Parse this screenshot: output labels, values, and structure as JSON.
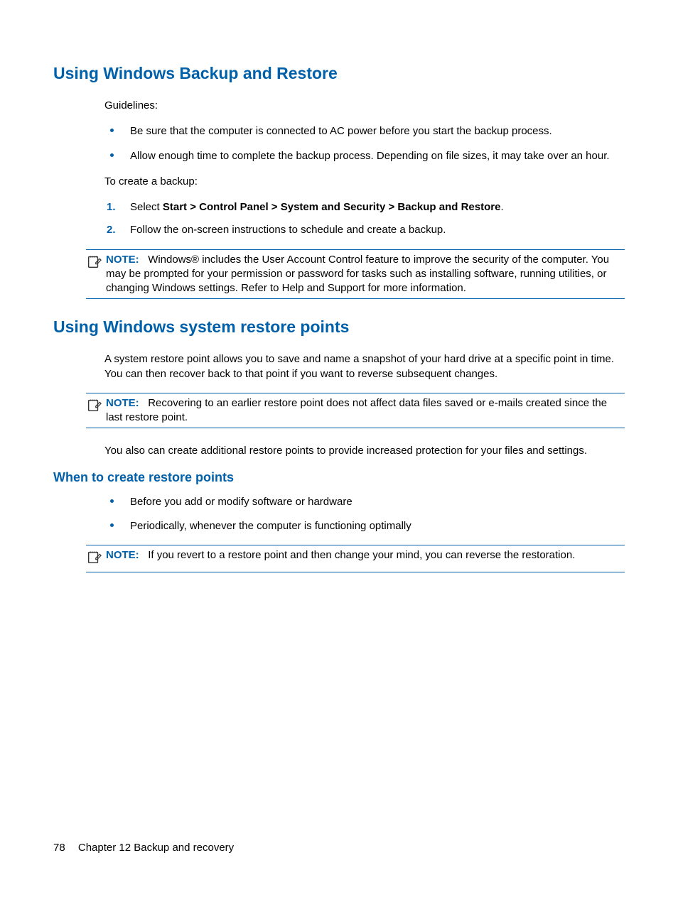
{
  "section1": {
    "heading": "Using Windows Backup and Restore",
    "guidelines_label": "Guidelines:",
    "bullets": [
      "Be sure that the computer is connected to AC power before you start the backup process.",
      "Allow enough time to complete the backup process. Depending on file sizes, it may take over an hour."
    ],
    "create_backup_label": "To create a backup:",
    "steps": [
      {
        "num": "1.",
        "prefix": "Select ",
        "bold": "Start > Control Panel > System and Security > Backup and Restore",
        "suffix": "."
      },
      {
        "num": "2.",
        "prefix": "Follow the on-screen instructions to schedule and create a backup.",
        "bold": "",
        "suffix": ""
      }
    ],
    "note": {
      "label": "NOTE:",
      "text": "Windows® includes the User Account Control feature to improve the security of the computer. You may be prompted for your permission or password for tasks such as installing software, running utilities, or changing Windows settings. Refer to Help and Support for more information."
    }
  },
  "section2": {
    "heading": "Using Windows system restore points",
    "p1": "A system restore point allows you to save and name a snapshot of your hard drive at a specific point in time. You can then recover back to that point if you want to reverse subsequent changes.",
    "note1": {
      "label": "NOTE:",
      "text": "Recovering to an earlier restore point does not affect data files saved or e-mails created since the last restore point."
    },
    "p2": "You also can create additional restore points to provide increased protection for your files and settings.",
    "subheading": "When to create restore points",
    "bullets": [
      "Before you add or modify software or hardware",
      "Periodically, whenever the computer is functioning optimally"
    ],
    "note2": {
      "label": "NOTE:",
      "text": "If you revert to a restore point and then change your mind, you can reverse the restoration."
    }
  },
  "footer": {
    "page_number": "78",
    "chapter": "Chapter 12   Backup and recovery"
  }
}
